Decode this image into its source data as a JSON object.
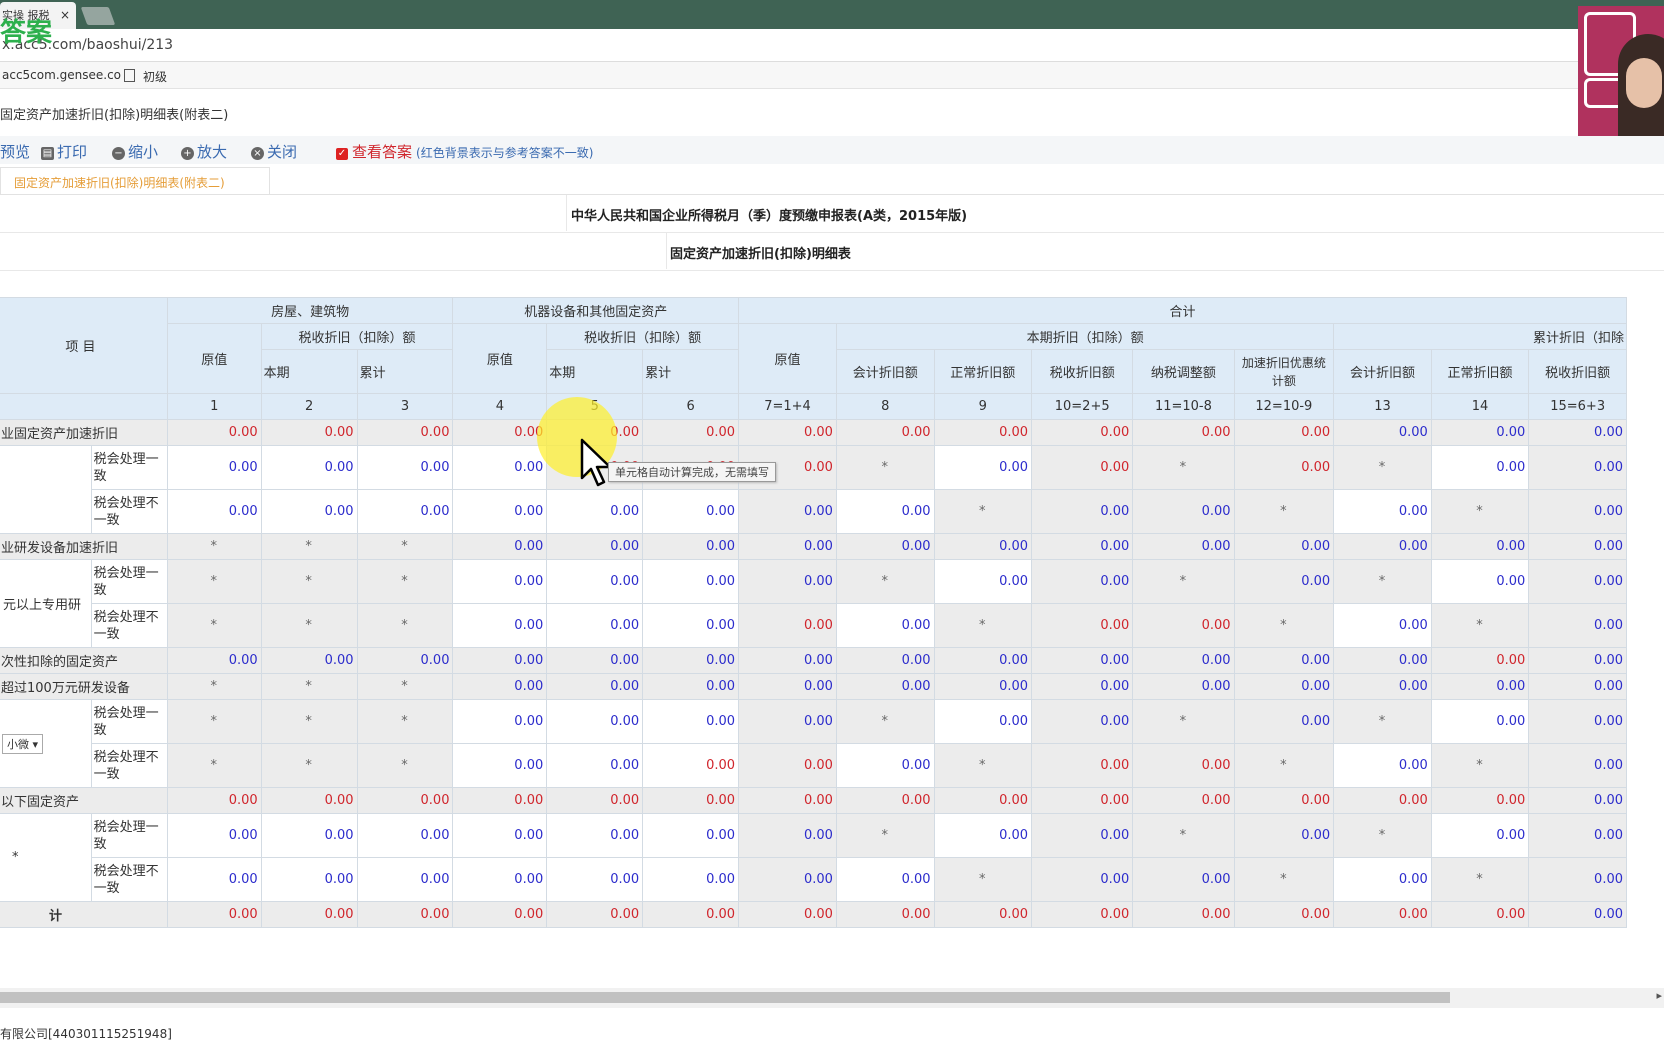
{
  "browser": {
    "tab_title": "实操 报税",
    "tab_close": "×",
    "logo_text": "答案",
    "url": "x.acc5.com/baoshui/213",
    "bookmarks": [
      "acc5com.gensee.co",
      "初级"
    ]
  },
  "form_title": "固定资产加速折旧(扣除)明细表(附表二)",
  "toolbar": {
    "preview": "预览",
    "print": "打印",
    "zoom_out": "缩小",
    "zoom_in": "放大",
    "close": "关闭",
    "show_answer": "查看答案",
    "answer_note": "(红色背景表示与参考答案不一致)"
  },
  "subtab": "固定资产加速折旧(扣除)明细表(附表二)",
  "report": {
    "title": "中华人民共和国企业所得税月（季）度预缴申报表(A类，2015年版)",
    "subtitle": "固定资产加速折旧(扣除)明细表"
  },
  "headers": {
    "item": "项        目",
    "group_buildings": "房屋、建筑物",
    "group_machines": "机器设备和其他固定资产",
    "group_total": "合计",
    "original_value": "原值",
    "tax_dep": "税收折旧（扣除）额",
    "current_dep": "本期折旧（扣除）额",
    "cumulative_dep": "累计折旧（扣除",
    "current": "本期",
    "cumulative": "累计",
    "accounting_dep": "会计折旧额",
    "normal_dep": "正常折旧额",
    "tax_dep_amount": "税收折旧额",
    "tax_adjust": "纳税调整额",
    "accel_benefit": "加速折旧优惠统计额",
    "col_numbers": [
      "1",
      "2",
      "3",
      "4",
      "5",
      "6",
      "7=1+4",
      "8",
      "9",
      "10=2+5",
      "11=10-8",
      "12=10-9",
      "13",
      "14",
      "15=6+3"
    ]
  },
  "row_labels": {
    "r1": "业固定资产加速折旧",
    "consistent": "税会处理一致",
    "inconsistent": "税会处理不一致",
    "r4": "业研发设备加速折旧",
    "r5_side": "元以上专用研",
    "r7": "次性扣除的固定资产",
    "r8": "超过100万元研发设备",
    "dropdown": "小微",
    "r11": "以下固定资产",
    "r12_side": "*",
    "total": "计"
  },
  "values": {
    "zero": "0.00",
    "star": "*"
  },
  "tooltip": "单元格自动计算完成，无需填写",
  "footer": "有限公司[440301115251948]",
  "colors": {
    "red_value": "#d0252c",
    "blue_value": "#2c2ccc",
    "header_bg": "#deebf7",
    "computed_bg": "#ececec"
  }
}
